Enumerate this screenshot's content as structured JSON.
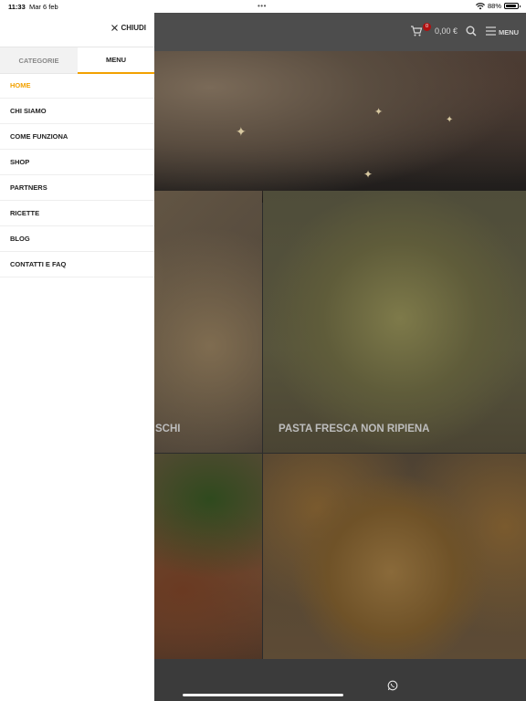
{
  "status_bar": {
    "time": "11:33",
    "date": "Mar 6 feb",
    "battery": "88%",
    "battery_level": 0.88,
    "icons": [
      "wifi-icon",
      "battery-icon"
    ]
  },
  "header": {
    "cart_count": "0",
    "cart_amount": "0,00 €",
    "menu_label": "MENU",
    "icons": [
      "cart-icon",
      "search-icon",
      "hamburger-icon"
    ]
  },
  "drawer": {
    "close_label": "CHIUDI",
    "tabs": [
      {
        "label": "CATEGORIE",
        "active": false
      },
      {
        "label": "MENU",
        "active": true
      }
    ],
    "items": [
      {
        "label": "HOME",
        "active": true
      },
      {
        "label": "CHI SIAMO",
        "active": false
      },
      {
        "label": "COME FUNZIONA",
        "active": false
      },
      {
        "label": "SHOP",
        "active": false
      },
      {
        "label": "PARTNERS",
        "active": false
      },
      {
        "label": "RICETTE",
        "active": false
      },
      {
        "label": "BLOG",
        "active": false
      },
      {
        "label": "CONTATTI E FAQ",
        "active": false
      }
    ]
  },
  "tiles": {
    "left_label": "SCHI",
    "right_label": "PASTA FRESCA NON RIPIENA"
  },
  "colors": {
    "accent": "#f2a100",
    "badge": "#b01010"
  }
}
